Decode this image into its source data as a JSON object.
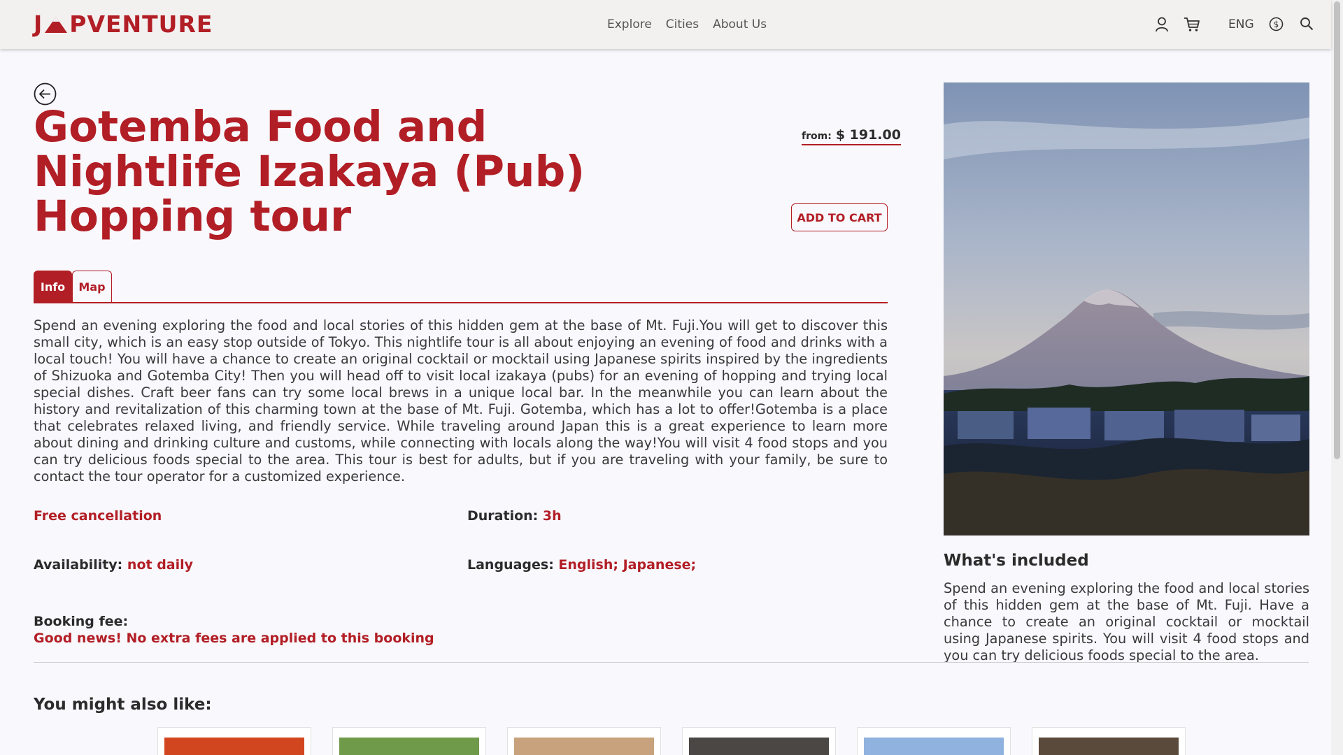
{
  "header": {
    "logo_text_left": "J",
    "logo_text_right": "PVENTURE",
    "nav": [
      "Explore",
      "Cities",
      "About Us"
    ],
    "language": "ENG",
    "icons": [
      "user-icon",
      "cart-icon",
      "currency-icon",
      "search-icon"
    ]
  },
  "tour": {
    "title": "Gotemba Food and Nightlife Izakaya (Pub) Hopping tour",
    "price_from_label": "from:",
    "price": "$ 191.00",
    "add_to_cart": "ADD TO CART",
    "tabs": [
      {
        "label": "Info",
        "active": true
      },
      {
        "label": "Map",
        "active": false
      }
    ],
    "description": "Spend an evening exploring the food and local stories of this hidden gem at the base of Mt. Fuji.You will get to discover this small city, which is an easy stop outside of Tokyo. This nightlife tour is all about enjoying an evening of food and drinks with a local touch! You will have a chance to create an original cocktail or mocktail using Japanese spirits inspired by the ingredients of Shizuoka and Gotemba City! Then you will head off to visit local izakaya (pubs) for an evening of hopping and trying local special dishes. Craft beer fans can try some local brews in a unique local bar. In the meanwhile you can learn about the history and revitalization of this charming town at the base of Mt. Fuji. Gotemba, which has a lot to offer!Gotemba is a place that celebrates relaxed living, and friendly service. While traveling around Japan this is a great experience to learn more about dining and drinking culture and customs, while connecting with locals along the way!You will visit 4 food stops and you can try delicious foods special to the area. This tour is best for adults, but if you are traveling with your family, be sure to contact the tour operator for a customized experience.",
    "free_cancellation": "Free cancellation",
    "duration_label": "Duration:",
    "duration_value": "3h",
    "availability_label": "Availability:",
    "availability_value": "not daily",
    "languages_label": "Languages:",
    "languages_value": "English; Japanese;",
    "booking_fee_label": "Booking fee:",
    "booking_fee_value": "Good news! No extra fees are applied to this booking"
  },
  "included": {
    "title": "What's included",
    "text": "Spend an evening exploring the food and local stories of this hidden gem at the base of Mt. Fuji. Have a chance to create an original cocktail or mocktail using Japanese spirits. You will visit 4 food stops and you can try delicious foods special to the area."
  },
  "suggestions": {
    "title": "You might also like:",
    "cards": [
      {
        "thumb_color": "#d2461f"
      },
      {
        "thumb_color": "#6f9a4a"
      },
      {
        "thumb_color": "#c7a27c"
      },
      {
        "thumb_color": "#4a4744"
      },
      {
        "thumb_color": "#8fb2de"
      },
      {
        "thumb_color": "#5a4a3c"
      }
    ]
  },
  "colors": {
    "accent": "#b21e25",
    "background": "#f8f8fd",
    "header_bg": "#f3f0f0"
  }
}
